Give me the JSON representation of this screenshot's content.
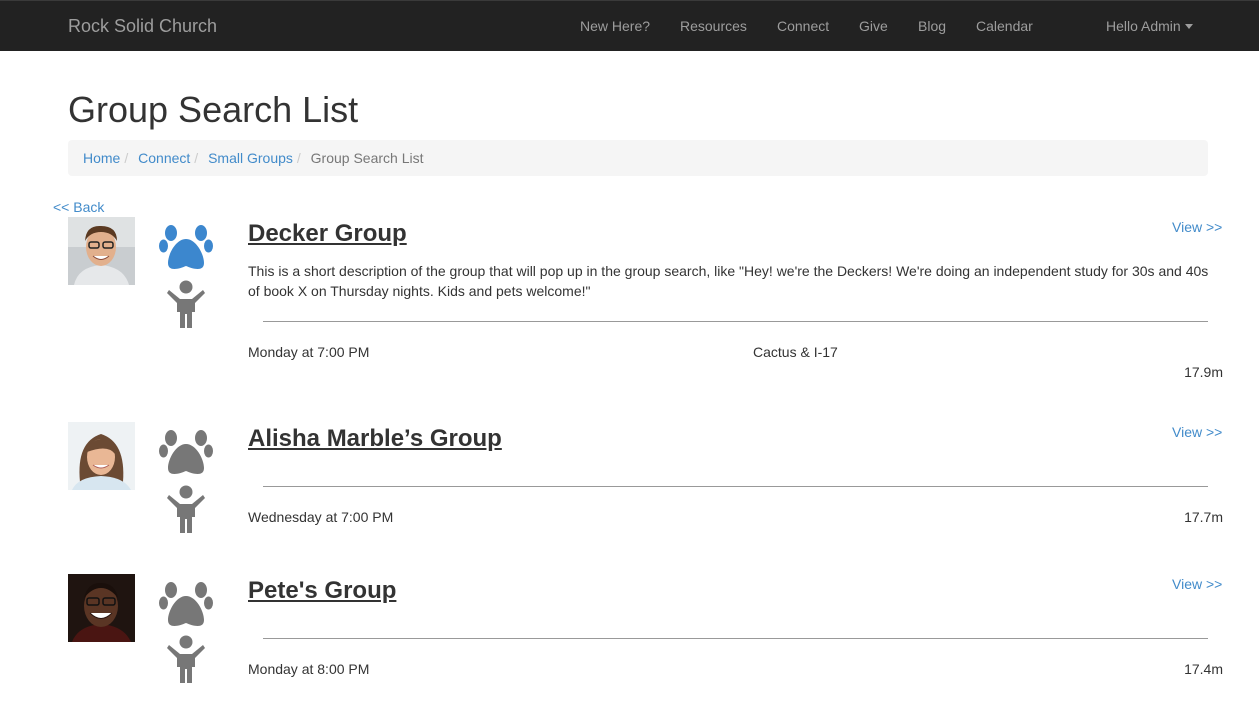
{
  "navbar": {
    "brand": "Rock Solid Church",
    "links": [
      "New Here?",
      "Resources",
      "Connect",
      "Give",
      "Blog",
      "Calendar"
    ],
    "user": "Hello Admin"
  },
  "page": {
    "title": "Group Search List",
    "back": "<< Back"
  },
  "breadcrumb": {
    "items": [
      "Home",
      "Connect",
      "Small Groups"
    ],
    "current": "Group Search List"
  },
  "colors": {
    "paw_active": "#3c87ce",
    "paw_inactive": "#777777",
    "link": "#428bca",
    "navbar": "#222222"
  },
  "groups": [
    {
      "name": "Decker Group",
      "view": "View >>",
      "description": "This is a short description of the group that will pop up in the group search, like \"Hey! we're the Deckers! We're doing an independent study for 30s and 40s of book X on Thursday nights. Kids and pets welcome!\"",
      "schedule": "Monday at 7:00 PM",
      "location": "Cactus & I-17",
      "distance": "17.9m",
      "pets_icon": "paw-icon",
      "kids_icon": "child-icon",
      "pets_welcome": true
    },
    {
      "name": "Alisha Marble’s Group",
      "view": "View >>",
      "schedule": "Wednesday at 7:00 PM",
      "distance": "17.7m",
      "pets_icon": "paw-icon",
      "kids_icon": "child-icon",
      "pets_welcome": false
    },
    {
      "name": "Pete's Group",
      "view": "View >>",
      "schedule": "Monday at 8:00 PM",
      "distance": "17.4m",
      "pets_icon": "paw-icon",
      "kids_icon": "child-icon",
      "pets_welcome": false
    }
  ]
}
